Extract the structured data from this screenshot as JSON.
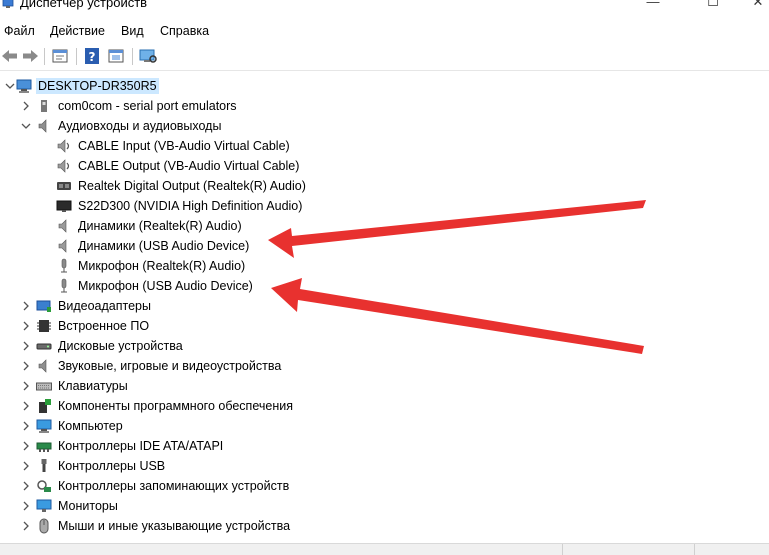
{
  "window": {
    "title": "Диспетчер устройств",
    "minimize": "—",
    "maximize": "☐",
    "close": "✕"
  },
  "menu": [
    "Файл",
    "Действие",
    "Вид",
    "Справка"
  ],
  "tree": {
    "root": "DESKTOP-DR350R5",
    "com0com": "com0com - serial port emulators",
    "audio": {
      "label": "Аудиовходы и аудиовыходы",
      "children": [
        "CABLE Input (VB-Audio Virtual Cable)",
        "CABLE Output (VB-Audio Virtual Cable)",
        "Realtek Digital Output (Realtek(R) Audio)",
        "S22D300 (NVIDIA High Definition Audio)",
        "Динамики (Realtek(R) Audio)",
        "Динамики (USB Audio Device)",
        "Микрофон (Realtek(R) Audio)",
        "Микрофон (USB Audio Device)"
      ]
    },
    "categories": [
      "Видеоадаптеры",
      "Встроенное ПО",
      "Дисковые устройства",
      "Звуковые, игровые и видеоустройства",
      "Клавиатуры",
      "Компоненты программного обеспечения",
      "Компьютер",
      "Контроллеры IDE ATA/ATAPI",
      "Контроллеры USB",
      "Контроллеры запоминающих устройств",
      "Мониторы",
      "Мыши и иные указывающие устройства"
    ]
  },
  "colors": {
    "selection": "#cce8ff",
    "arrow": "#e8312f",
    "chevron": "#555555"
  }
}
